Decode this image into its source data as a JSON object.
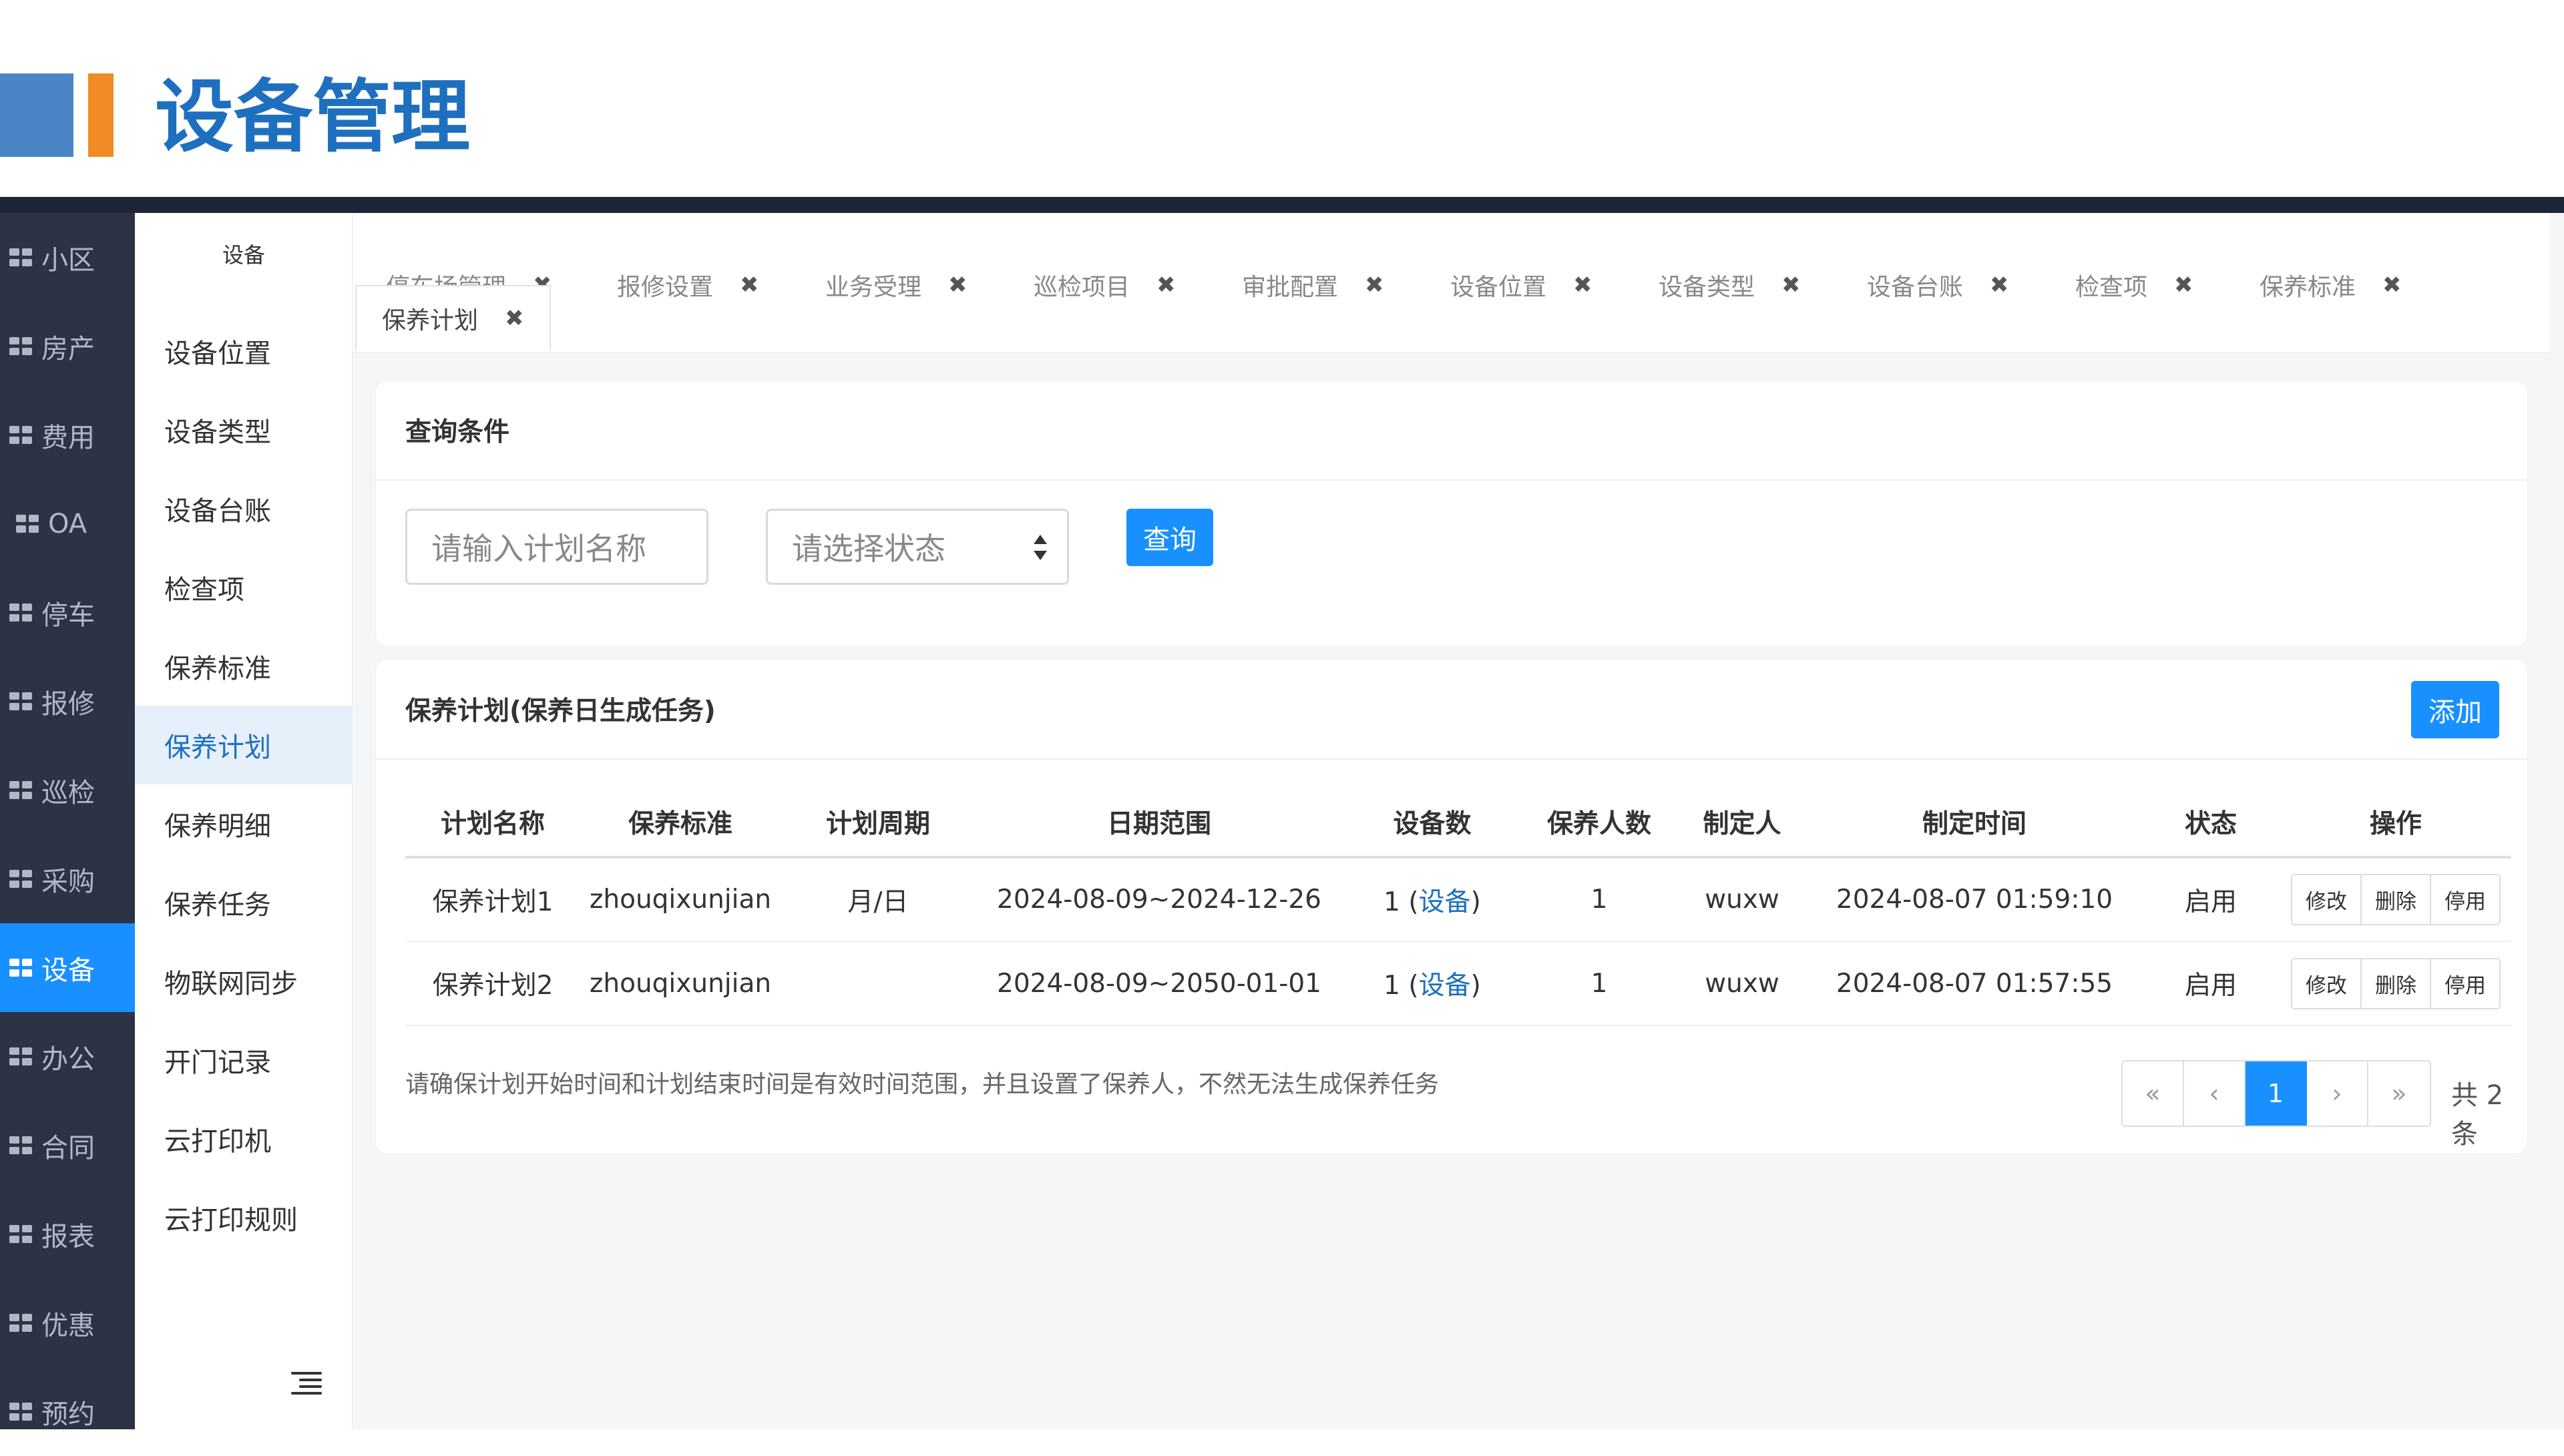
{
  "slide": {
    "title": "设备管理"
  },
  "left_nav": {
    "items": [
      {
        "label": "小区"
      },
      {
        "label": "房产"
      },
      {
        "label": "费用"
      },
      {
        "label": "OA"
      },
      {
        "label": "停车"
      },
      {
        "label": "报修"
      },
      {
        "label": "巡检"
      },
      {
        "label": "采购"
      },
      {
        "label": "设备",
        "active": true
      },
      {
        "label": "办公"
      },
      {
        "label": "合同"
      },
      {
        "label": "报表"
      },
      {
        "label": "优惠"
      },
      {
        "label": "预约"
      }
    ]
  },
  "sub_nav": {
    "title": "设备",
    "items": [
      {
        "label": "设备位置"
      },
      {
        "label": "设备类型"
      },
      {
        "label": "设备台账"
      },
      {
        "label": "检查项"
      },
      {
        "label": "保养标准"
      },
      {
        "label": "保养计划",
        "active": true
      },
      {
        "label": "保养明细"
      },
      {
        "label": "保养任务"
      },
      {
        "label": "物联网同步"
      },
      {
        "label": "开门记录"
      },
      {
        "label": "云打印机"
      },
      {
        "label": "云打印规则"
      }
    ],
    "collapse_icon": "collapse-menu-icon"
  },
  "tabs": [
    {
      "label": "停车场管理"
    },
    {
      "label": "报修设置"
    },
    {
      "label": "业务受理"
    },
    {
      "label": "巡检项目"
    },
    {
      "label": "审批配置"
    },
    {
      "label": "设备位置"
    },
    {
      "label": "设备类型"
    },
    {
      "label": "设备台账"
    },
    {
      "label": "检查项"
    },
    {
      "label": "保养标准"
    },
    {
      "label": "保养计划",
      "active": true
    }
  ],
  "tab_close_glyph": "✖",
  "query": {
    "title": "查询条件",
    "name_placeholder": "请输入计划名称",
    "status_placeholder": "请选择状态",
    "search_label": "查询"
  },
  "plan": {
    "title": "保养计划(保养日生成任务)",
    "add_label": "添加",
    "columns": [
      "计划名称",
      "保养标准",
      "计划周期",
      "日期范围",
      "设备数",
      "保养人数",
      "制定人",
      "制定时间",
      "状态",
      "操作"
    ],
    "rows": [
      {
        "name": "保养计划1",
        "standard": "zhouqixunjian",
        "cycle": "月/日",
        "range": "2024-08-09~2024-12-26",
        "device_count": "1",
        "device_link": "设备",
        "people": "1",
        "creator": "wuxw",
        "created": "2024-08-07 01:59:10",
        "status": "启用"
      },
      {
        "name": "保养计划2",
        "standard": "zhouqixunjian",
        "cycle": "",
        "range": "2024-08-09~2050-01-01",
        "device_count": "1",
        "device_link": "设备",
        "people": "1",
        "creator": "wuxw",
        "created": "2024-08-07 01:57:55",
        "status": "启用"
      }
    ],
    "ops": {
      "edit": "修改",
      "delete": "删除",
      "disable": "停用"
    },
    "note": "请确保计划开始时间和计划结束时间是有效时间范围，并且设置了保养人，不然无法生成保养任务",
    "pager": {
      "first": "«",
      "prev": "‹",
      "current": "1",
      "next": "›",
      "last": "»",
      "total": "共 2 条"
    }
  },
  "colors": {
    "accent": "#1890ff",
    "nav_bg": "#2c3345",
    "title_blue": "#1f6fbf",
    "header_orange": "#f08a24"
  }
}
